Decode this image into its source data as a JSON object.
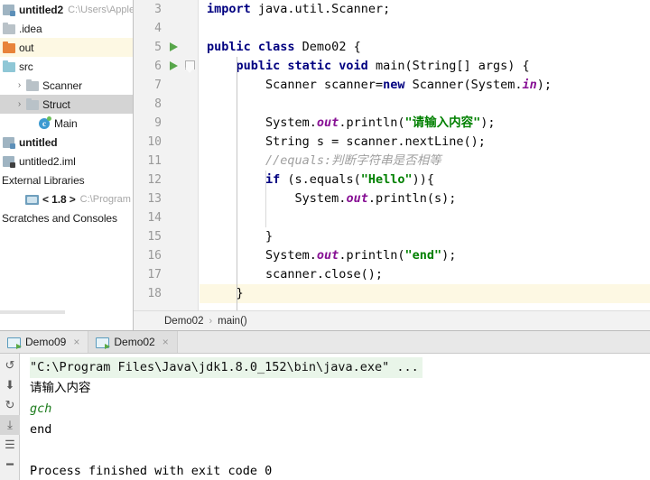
{
  "project_tree": {
    "name": "project-tree",
    "rows": [
      {
        "indent": 0,
        "arrow": "",
        "icon": "module-icon",
        "label": "untitled2",
        "bold": true,
        "sub": "C:\\Users\\Apple",
        "highlight": "none"
      },
      {
        "indent": 0,
        "arrow": "",
        "icon": "folder-icon",
        "label": ".idea",
        "bold": false,
        "sub": "",
        "highlight": "none"
      },
      {
        "indent": 0,
        "arrow": "",
        "icon": "folder-out-icon",
        "label": "out",
        "bold": false,
        "sub": "",
        "highlight": "cream"
      },
      {
        "indent": 0,
        "arrow": "",
        "icon": "folder-src-icon",
        "label": "src",
        "bold": false,
        "sub": "",
        "highlight": "none"
      },
      {
        "indent": 1,
        "arrow": "›",
        "icon": "folder-icon",
        "label": "Scanner",
        "bold": false,
        "sub": "",
        "highlight": "none"
      },
      {
        "indent": 1,
        "arrow": "›",
        "icon": "folder-icon",
        "label": "Struct",
        "bold": false,
        "sub": "",
        "highlight": "selected"
      },
      {
        "indent": 2,
        "arrow": "",
        "icon": "java-class-icon",
        "label": "Main",
        "bold": false,
        "sub": "",
        "highlight": "none"
      },
      {
        "indent": 0,
        "arrow": "",
        "icon": "module-icon",
        "label": "untitled",
        "bold": true,
        "sub": "",
        "highlight": "none"
      },
      {
        "indent": 0,
        "arrow": "",
        "icon": "module-file-icon",
        "label": "untitled2.iml",
        "bold": false,
        "sub": "",
        "highlight": "none"
      },
      {
        "indent": 0,
        "arrow": "",
        "icon": "none",
        "label": "External Libraries",
        "bold": false,
        "sub": "",
        "highlight": "none"
      },
      {
        "indent": 1,
        "arrow": "",
        "icon": "library-icon",
        "label": "< 1.8 >",
        "bold": true,
        "sub": "C:\\Program Fi",
        "highlight": "none"
      },
      {
        "indent": 0,
        "arrow": "",
        "icon": "none",
        "label": "Scratches and Consoles",
        "bold": false,
        "sub": "",
        "highlight": "none"
      }
    ]
  },
  "editor": {
    "name": "code-editor",
    "first_line_number": 3,
    "gutter_run_markers": [
      5,
      6
    ],
    "fold_marker_line": 6,
    "highlighted_line": 18,
    "lines": [
      {
        "n": 3,
        "tokens": [
          {
            "t": "kw",
            "v": "import"
          },
          {
            "t": "pln",
            "v": " java.util.Scanner;"
          }
        ]
      },
      {
        "n": 4,
        "tokens": []
      },
      {
        "n": 5,
        "tokens": [
          {
            "t": "kw",
            "v": "public class"
          },
          {
            "t": "pln",
            "v": " Demo02 {"
          }
        ]
      },
      {
        "n": 6,
        "tokens": [
          {
            "t": "pln",
            "v": "    "
          },
          {
            "t": "kw",
            "v": "public static void"
          },
          {
            "t": "pln",
            "v": " main(String[] args) {"
          }
        ]
      },
      {
        "n": 7,
        "tokens": [
          {
            "t": "pln",
            "v": "        Scanner scanner="
          },
          {
            "t": "kw",
            "v": "new"
          },
          {
            "t": "pln",
            "v": " Scanner(System."
          },
          {
            "t": "fld",
            "v": "in"
          },
          {
            "t": "pln",
            "v": ");"
          }
        ]
      },
      {
        "n": 8,
        "tokens": []
      },
      {
        "n": 9,
        "tokens": [
          {
            "t": "pln",
            "v": "        System."
          },
          {
            "t": "fld",
            "v": "out"
          },
          {
            "t": "pln",
            "v": ".println("
          },
          {
            "t": "str",
            "v": "\"请输入内容\""
          },
          {
            "t": "pln",
            "v": ");"
          }
        ]
      },
      {
        "n": 10,
        "tokens": [
          {
            "t": "pln",
            "v": "        String s = scanner.nextLine();"
          }
        ]
      },
      {
        "n": 11,
        "tokens": [
          {
            "t": "pln",
            "v": "        "
          },
          {
            "t": "cm",
            "v": "//equals:判断字符串是否相等"
          }
        ]
      },
      {
        "n": 12,
        "tokens": [
          {
            "t": "pln",
            "v": "        "
          },
          {
            "t": "kw",
            "v": "if"
          },
          {
            "t": "pln",
            "v": " (s.equals("
          },
          {
            "t": "str",
            "v": "\"Hello\""
          },
          {
            "t": "pln",
            "v": ")){"
          }
        ]
      },
      {
        "n": 13,
        "tokens": [
          {
            "t": "pln",
            "v": "            System."
          },
          {
            "t": "fld",
            "v": "out"
          },
          {
            "t": "pln",
            "v": ".println(s);"
          }
        ]
      },
      {
        "n": 14,
        "tokens": []
      },
      {
        "n": 15,
        "tokens": [
          {
            "t": "pln",
            "v": "        }"
          }
        ]
      },
      {
        "n": 16,
        "tokens": [
          {
            "t": "pln",
            "v": "        System."
          },
          {
            "t": "fld",
            "v": "out"
          },
          {
            "t": "pln",
            "v": ".println("
          },
          {
            "t": "str",
            "v": "\"end\""
          },
          {
            "t": "pln",
            "v": ");"
          }
        ]
      },
      {
        "n": 17,
        "tokens": [
          {
            "t": "pln",
            "v": "        scanner.close();"
          }
        ]
      },
      {
        "n": 18,
        "tokens": [
          {
            "t": "pln",
            "v": "    }"
          }
        ]
      }
    ]
  },
  "breadcrumb": {
    "name": "editor-breadcrumb",
    "items": [
      "Demo02",
      "main()"
    ],
    "separator": "›"
  },
  "run_window": {
    "name": "run-tool-window",
    "tabs": [
      {
        "label": "Demo09",
        "active": false,
        "close": "×"
      },
      {
        "label": "Demo02",
        "active": true,
        "close": "×"
      }
    ],
    "toolbar": [
      {
        "name": "rerun-button",
        "glyph": "↺",
        "selected": false
      },
      {
        "name": "stop-button",
        "glyph": "⬇",
        "selected": false
      },
      {
        "name": "restart-button",
        "glyph": "↻",
        "selected": false
      },
      {
        "name": "scroll-to-end-button",
        "glyph": "⤓",
        "selected": true
      },
      {
        "name": "print-button",
        "glyph": "☰",
        "selected": false
      },
      {
        "name": "soft-wrap-button",
        "glyph": "━",
        "selected": false
      }
    ],
    "console": {
      "name": "console-output",
      "lines": [
        {
          "style": "cmd",
          "text": "\"C:\\Program Files\\Java\\jdk1.8.0_152\\bin\\java.exe\" ..."
        },
        {
          "style": "cjk",
          "text": "请输入内容"
        },
        {
          "style": "input",
          "text": "gch"
        },
        {
          "style": "plain",
          "text": "end"
        },
        {
          "style": "plain",
          "text": ""
        },
        {
          "style": "plain",
          "text": "Process finished with exit code 0"
        }
      ]
    }
  },
  "colors": {
    "keyword": "#000080",
    "string": "#008000",
    "comment": "#a0a0a0",
    "field": "#871094",
    "run_marker_green": "#57a64a",
    "highlight_cream": "#fdf8e3",
    "selection_gray": "#d4d4d4",
    "console_cmd_bg": "#e9f5e9",
    "console_input_green": "#1a7a1a"
  }
}
